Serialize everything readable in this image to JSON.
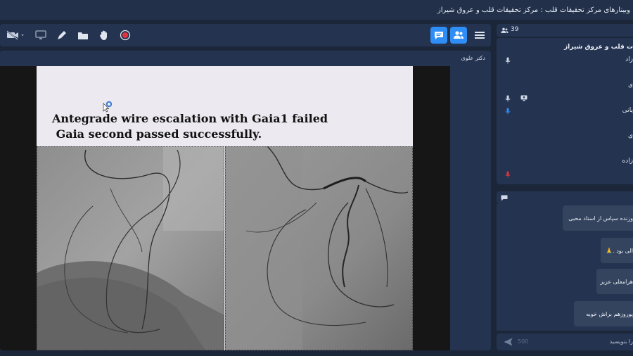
{
  "window": {
    "title": "وبینارهای مرکز تحقیقات قلب : مرکز تحقیقات قلب و عروق شیراز"
  },
  "stage": {
    "presenter_name": "دکتر علوی",
    "slide": {
      "line1": "Antegrade wire escalation with Gaia1 failed",
      "line2": " Gaia second passed successfully."
    }
  },
  "users": {
    "count": "39",
    "header": "ت قلب و عروق شیراز",
    "rows": [
      {
        "name": "زاد",
        "mic": "muted"
      },
      {
        "name": "ی",
        "mic": "none"
      },
      {
        "name": "",
        "mic": "muted"
      },
      {
        "name": "یانی",
        "mic": "active"
      },
      {
        "name": "ی",
        "mic": "none"
      },
      {
        "name": "زاده",
        "mic": "none"
      },
      {
        "name": "",
        "mic": "muted-red"
      }
    ]
  },
  "chat": {
    "messages": [
      "وزنده سپاس از استاد محبی",
      "الی بود .🙏",
      "هرامعلی عزیز",
      "پوروزهم براش خوبه"
    ],
    "char_limit": "500",
    "placeholder": "را بنویسید"
  },
  "icons": {
    "toolbar_left": [
      "camera-off-icon",
      "screen-share-icon",
      "pen-icon",
      "folder-icon",
      "hand-icon",
      "record-icon"
    ],
    "toolbar_right": [
      "chat-icon",
      "users-icon",
      "menu-icon"
    ]
  },
  "colors": {
    "accent": "#2f8ef6",
    "panel": "#243350",
    "background": "#1b2639",
    "record": "#e2333f"
  }
}
